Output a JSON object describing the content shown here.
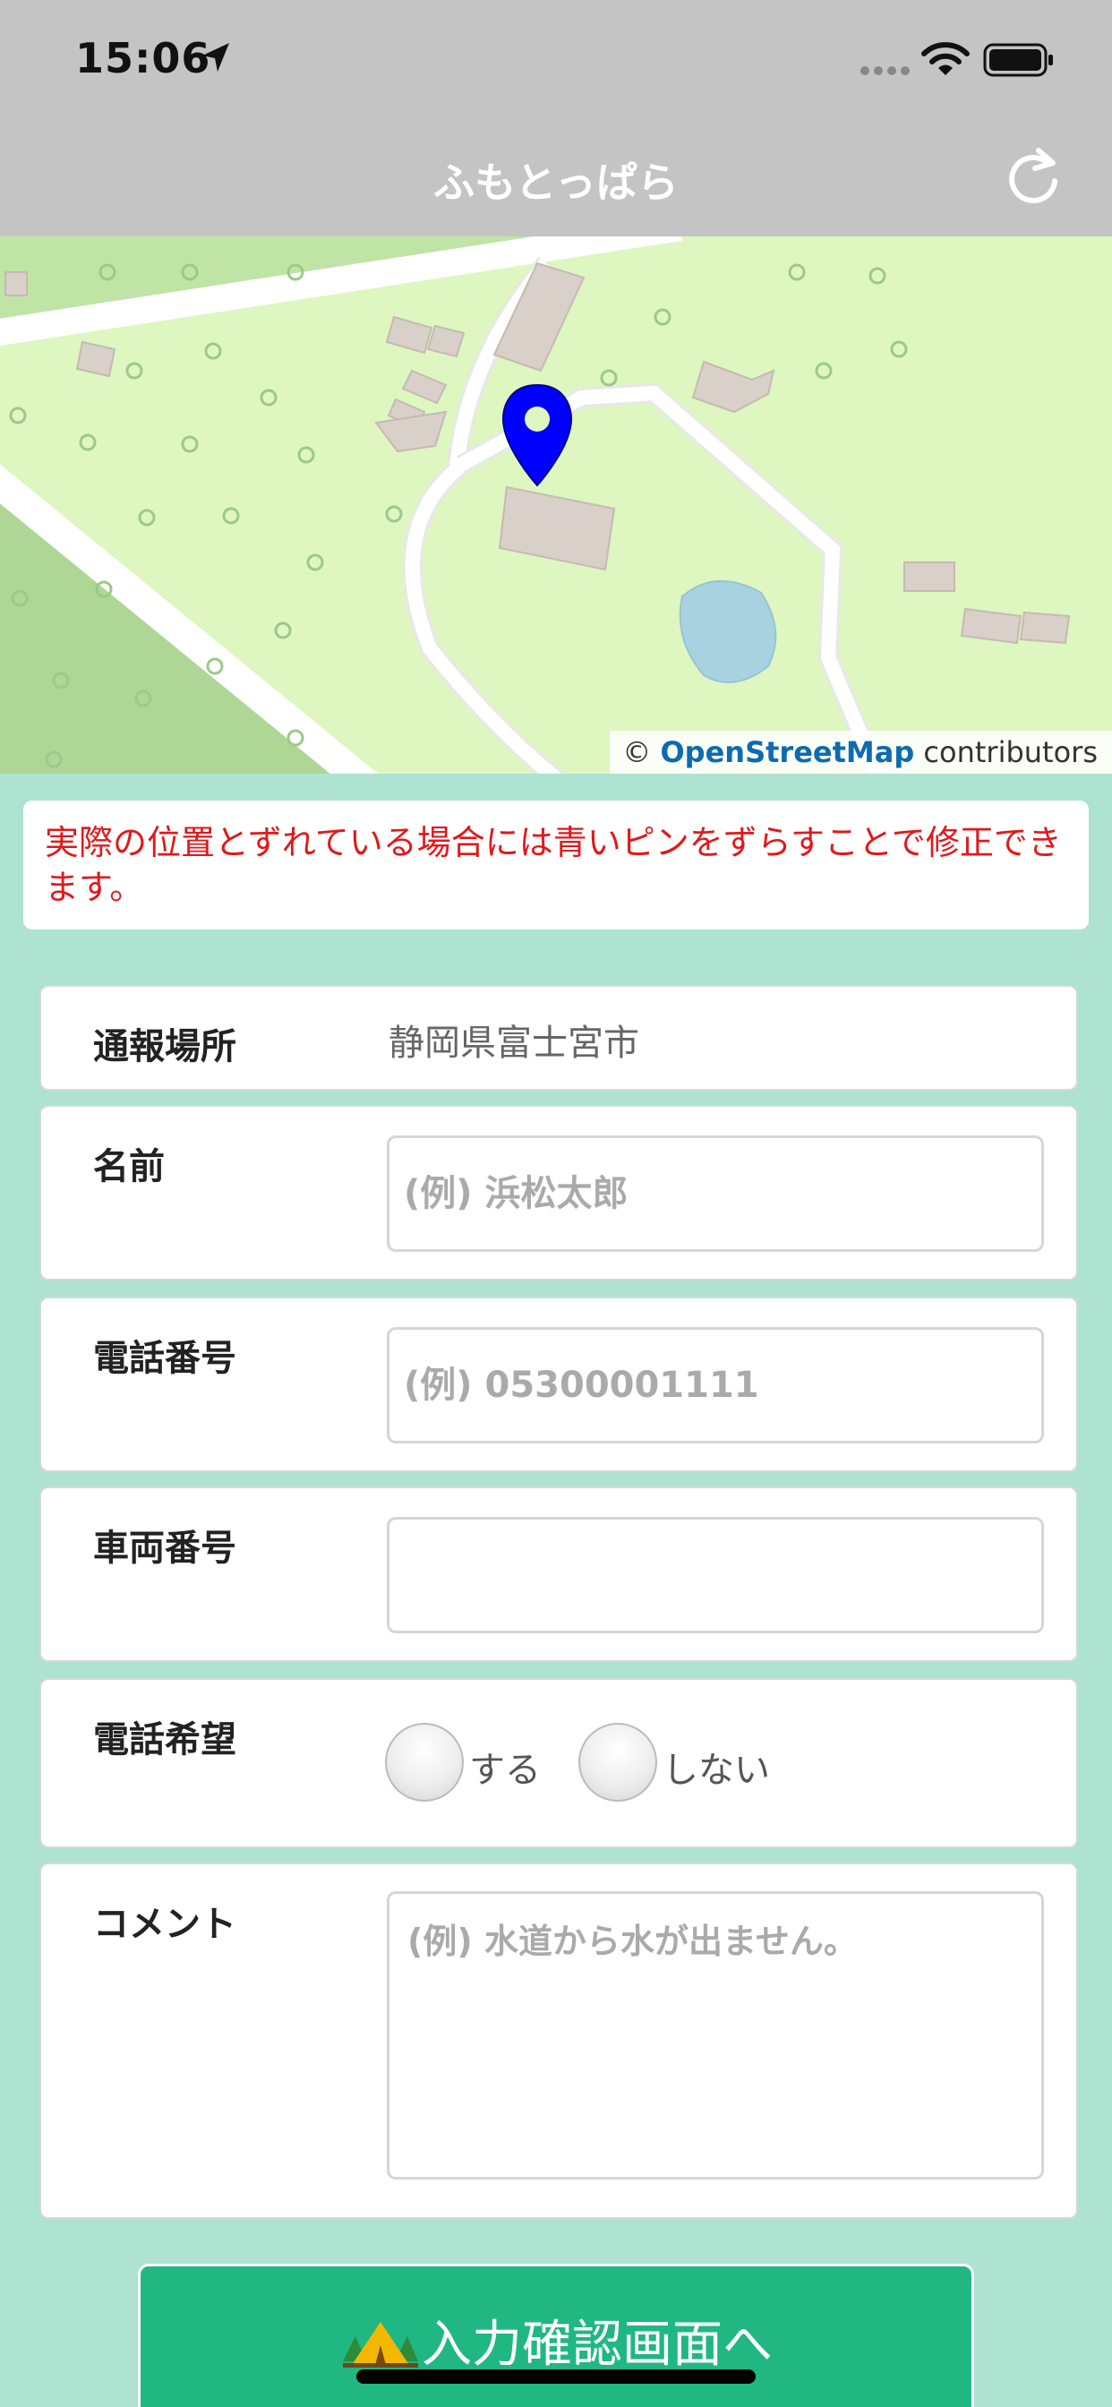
{
  "status_bar": {
    "time": "15:06"
  },
  "nav": {
    "title": "ふもとっぱら"
  },
  "map": {
    "attribution_prefix": "©",
    "attribution_link": "OpenStreetMap",
    "attribution_suffix": "contributors",
    "pin_color": "#0000ff"
  },
  "notice": {
    "text": "実際の位置とずれている場合には青いピンをずらすことで修正できます。"
  },
  "form": {
    "location": {
      "label": "通報場所",
      "value": "静岡県富士宮市"
    },
    "name": {
      "label": "名前",
      "placeholder": "(例) 浜松太郎"
    },
    "phone": {
      "label": "電話番号",
      "placeholder": "(例) 05300001111"
    },
    "vehicle": {
      "label": "車両番号",
      "placeholder": ""
    },
    "callback": {
      "label": "電話希望",
      "option_yes": "する",
      "option_no": "しない"
    },
    "comment": {
      "label": "コメント",
      "placeholder": "(例) 水道から水が出ません。"
    }
  },
  "submit": {
    "label": "入力確認画面へ"
  },
  "colors": {
    "accent": "#20b783",
    "background": "#aee2d1",
    "navbar": "#c4c4c4",
    "warning": "#e0191b"
  }
}
